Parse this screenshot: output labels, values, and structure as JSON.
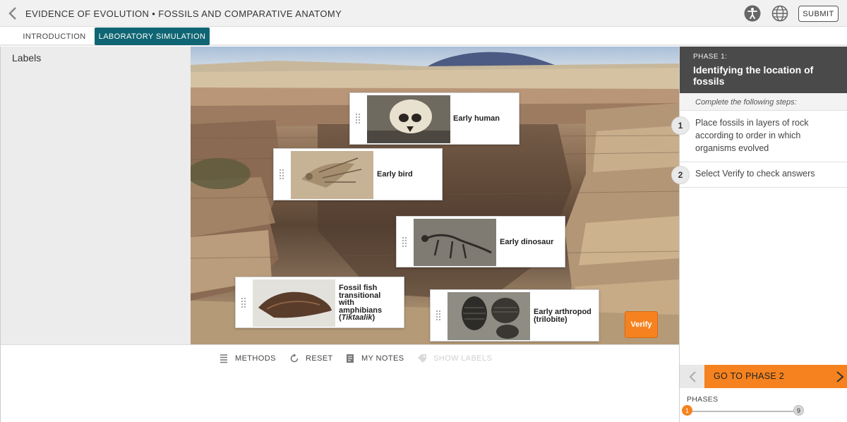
{
  "header": {
    "title": "EVIDENCE OF EVOLUTION • FOSSILS AND COMPARATIVE ANATOMY",
    "submit_label": "SUBMIT",
    "icons": [
      "back-arrow-icon",
      "accessibility-icon",
      "globe-icon"
    ]
  },
  "tabs": [
    {
      "label": "INTRODUCTION",
      "active": false
    },
    {
      "label": "LABORATORY SIMULATION",
      "active": true
    }
  ],
  "labels_panel": {
    "title": "Labels"
  },
  "fossils": [
    {
      "name": "Early human"
    },
    {
      "name": "Early bird"
    },
    {
      "name": "Early dinosaur"
    },
    {
      "name_lines": [
        "Fossil fish",
        "transitional",
        "with",
        "amphibians"
      ],
      "italic_name": "Tiktaalik"
    },
    {
      "name_lines": [
        "Early arthropod",
        "(trilobite)"
      ]
    }
  ],
  "verify_label": "Verify",
  "toolbar": {
    "methods": "METHODS",
    "reset": "RESET",
    "notes": "MY NOTES",
    "show_labels": "SHOW LABELS"
  },
  "phase": {
    "number_label": "PHASE 1:",
    "title": "Identifying the location of fossils",
    "intro": "Complete the following steps:",
    "steps": [
      {
        "num": "1",
        "text": "Place fossils in layers of rock according to order in which organisms evolved"
      },
      {
        "num": "2",
        "text": "Select Verify to check answers"
      }
    ],
    "next_label": "GO TO PHASE 2",
    "phases_label": "PHASES",
    "current_phase": "1",
    "total_phases": "9"
  },
  "colors": {
    "accent": "#0f6573",
    "orange": "#f5821f",
    "phase_header": "#4a4a4a"
  }
}
